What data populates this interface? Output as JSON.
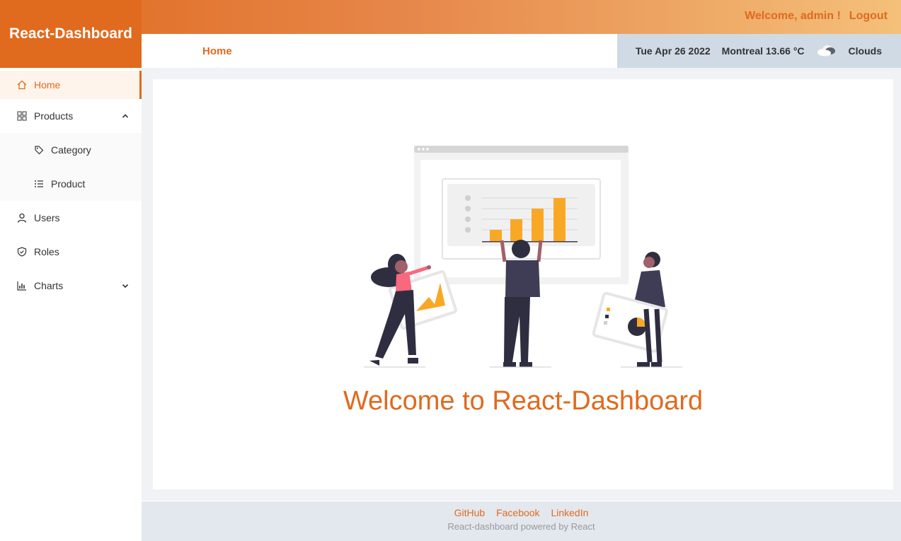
{
  "app": {
    "brand": "React-Dashboard"
  },
  "topbar": {
    "welcome": "Welcome, admin !",
    "logout": "Logout"
  },
  "header": {
    "tab": "Home",
    "date": "Tue Apr 26 2022",
    "weather_location": "Montreal 13.66 °C",
    "weather_icon": "cloud-icon",
    "weather_desc": "Clouds"
  },
  "sidebar": {
    "items": [
      {
        "label": "Home",
        "icon": "home-icon"
      },
      {
        "label": "Products",
        "icon": "grid-icon"
      },
      {
        "label": "Category",
        "icon": "tag-icon"
      },
      {
        "label": "Product",
        "icon": "list-icon"
      },
      {
        "label": "Users",
        "icon": "user-icon"
      },
      {
        "label": "Roles",
        "icon": "shield-icon"
      },
      {
        "label": "Charts",
        "icon": "bar-chart-icon"
      }
    ]
  },
  "main": {
    "welcome": "Welcome to React-Dashboard"
  },
  "footer": {
    "links": [
      "GitHub",
      "Facebook",
      "LinkedIn"
    ],
    "copyright": "React-dashboard powered by React"
  },
  "colors": {
    "accent": "#e06a1e",
    "weather_bg": "#cfdae4",
    "content_bg": "#f0f2f5",
    "illustration_bar": "#f9a826",
    "illustration_dark": "#2f2e41"
  }
}
